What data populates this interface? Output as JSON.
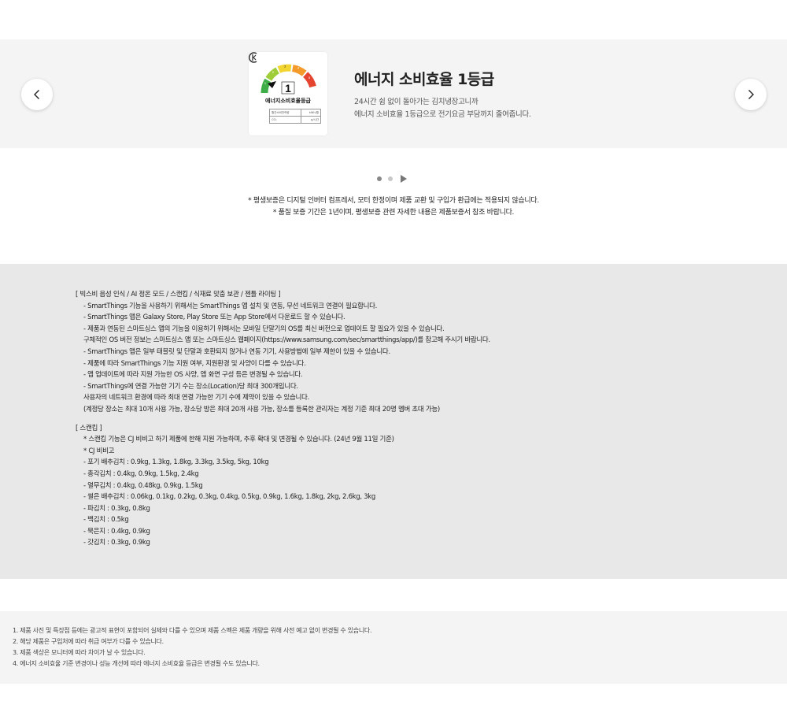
{
  "carousel": {
    "prev_label": "이전",
    "next_label": "다음",
    "title": "에너지 소비효율 1등급",
    "description": [
      "24시간 쉼 없이 돌아가는 김치냉장고니까",
      "에너지 소비효율 1등급으로 전기요금 부담까지 줄여줍니다."
    ],
    "energy_label": {
      "grade": "1",
      "grade_numbers": [
        "1",
        "2",
        "3",
        "4",
        "5"
      ],
      "title": "에너지소비효율등급",
      "rows": [
        [
          "월간소비전력량",
          "kWh/월"
        ],
        [
          "CO₂",
          "g/시간"
        ]
      ],
      "colors": [
        "#3fae49",
        "#9fcd3a",
        "#f2d530",
        "#f39a2b",
        "#e5452f"
      ]
    }
  },
  "indicators": {
    "dots": [
      {
        "state": "active"
      },
      {
        "state": "inactive"
      }
    ],
    "play_icon": "play-icon"
  },
  "warranty": [
    "* 평생보증은 디지털 인버터 컴프레서, 모터 한정이며 제품 교환 및 구입가 환급에는 적용되지 않습니다.",
    "* 품질 보증 기간은 1년이며, 평생보증 관련 자세한 내용은 제품보증서 참조 바랍니다."
  ],
  "notes": {
    "section1": [
      {
        "text": "[ 빅스비 음성 인식 / AI 정온 모드 / 스캔킵 / 식재료 맞춤 보관 / 젠틀 라이팅 ]",
        "indent": false
      },
      {
        "text": "- SmartThings 기능을 사용하기 위해서는 SmartThings 앱 설치 및 연동, 무선 네트워크 연결이 필요합니다.",
        "indent": true
      },
      {
        "text": "- SmartThings 앱은 Galaxy Store, Play Store 또는 App Store에서 다운로드 할 수 있습니다.",
        "indent": true
      },
      {
        "text": "- 제품과 연동된 스마트싱스 앱의 기능을 이용하기 위해서는 모바일 단말기의 OS를 최신 버전으로 업데이트 할 필요가 있을 수 있습니다.",
        "indent": true
      },
      {
        "text": "구체적인 OS 버전 정보는 스마트싱스 앱 또는 스마트싱스 웹페이지(https://www.samsung.com/sec/smartthings/app/)를 참고해 주시기 바랍니다.",
        "indent": true
      },
      {
        "text": "- SmartThings 앱은 일부 태블릿 및 단말과 호환되지 않거나 연동 기기, 사용방법에 일부 제한이 있을 수 있습니다.",
        "indent": true
      },
      {
        "text": "- 제품에 따라 SmartThings 기능 지원 여부, 지원환경 및 사양이 다를 수 있습니다.",
        "indent": true
      },
      {
        "text": "- 앱 업데이트에 따라 지원 가능한 OS 사양, 앱 화면 구성 등은 변경될 수 있습니다.",
        "indent": true
      },
      {
        "text": "- SmartThings에 연결 가능한 기기 수는 장소(Location)당 최대 300개입니다.",
        "indent": true
      },
      {
        "text": "사용자의 네트워크 환경에 따라 최대 연결 가능한 기기 수에 제약이 있을 수 있습니다.",
        "indent": true
      },
      {
        "text": "(계정당 장소는 최대 10개 사용 가능, 장소당 방은 최대 20개 사용 가능, 장소를 등록한 관리자는 계정 기준 최대 20명 멤버 초대 가능)",
        "indent": true
      }
    ],
    "section2": [
      {
        "text": "[ 스캔킵 ]",
        "indent": false
      },
      {
        "text": "* 스캔킵 기능은 CJ 비비고 하기 제품에 한해 지원 가능하며, 추후 확대 및 변경될 수 있습니다. (24년 9월 11일 기준)",
        "indent": true
      },
      {
        "text": "* CJ 비비고",
        "indent": true
      },
      {
        "text": "- 포기 배추김치 : 0.9kg, 1.3kg, 1.8kg, 3.3kg, 3.5kg, 5kg, 10kg",
        "indent": true
      },
      {
        "text": "- 총각김치 : 0.4kg, 0.9kg, 1.5kg, 2.4kg",
        "indent": true
      },
      {
        "text": "- 열무김치 : 0.4kg, 0.48kg, 0.9kg, 1.5kg",
        "indent": true
      },
      {
        "text": "- 썰은 배추김치 : 0.06kg, 0.1kg, 0.2kg, 0.3kg, 0.4kg, 0.5kg, 0.9kg, 1.6kg, 1.8kg, 2kg, 2.6kg, 3kg",
        "indent": true
      },
      {
        "text": "- 파김치 : 0.3kg, 0.8kg",
        "indent": true
      },
      {
        "text": "- 백김치 : 0.5kg",
        "indent": true
      },
      {
        "text": "- 묵은지 : 0.4kg, 0.9kg",
        "indent": true
      },
      {
        "text": "- 갓김치 : 0.3kg, 0.9kg",
        "indent": true
      }
    ]
  },
  "disclaimer": [
    "1. 제품 사진 및 특장점 등에는 광고적 표현이 포함되어 실제와 다를 수 있으며 제품 스펙은 제품 개량을 위해 사전 예고 없이 변경될 수 있습니다.",
    "2. 해당 제품은 구입처에 따라 취급 여부가 다를 수 있습니다.",
    "3. 제품 색상은 모니터에 따라 차이가 날 수 있습니다.",
    "4. 에너지 소비효율 기준 변경이나 성능 개선에 따라 에너지 소비효율 등급은 변경될 수도 있습니다."
  ]
}
